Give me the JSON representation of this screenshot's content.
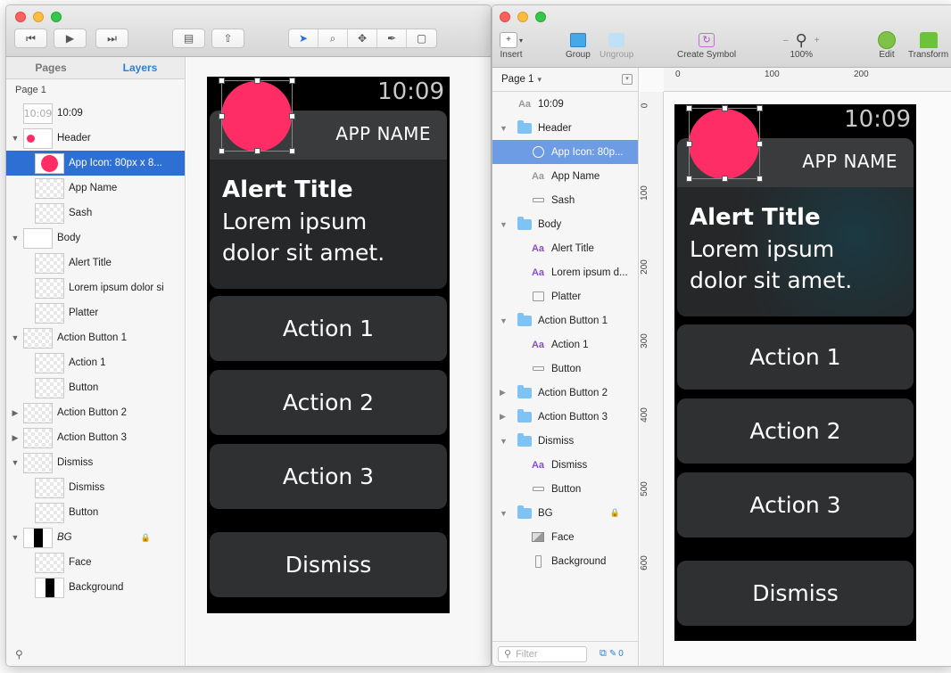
{
  "left": {
    "sidebar": {
      "tabs": [
        "Pages",
        "Layers"
      ],
      "page_label": "Page 1",
      "layers": [
        {
          "label": "10:09",
          "thumb": "time",
          "level": 0,
          "sel": false
        },
        {
          "label": "Header",
          "thumb": "dot",
          "level": 0,
          "sel": false,
          "expand": "open"
        },
        {
          "label": "App Icon: 80px x 8...",
          "thumb": "circle",
          "level": 1,
          "sel": true
        },
        {
          "label": "App Name",
          "thumb": "check",
          "level": 1,
          "sel": false
        },
        {
          "label": "Sash",
          "thumb": "check",
          "level": 1,
          "sel": false
        },
        {
          "label": "Body",
          "thumb": "plain",
          "level": 0,
          "sel": false,
          "expand": "open"
        },
        {
          "label": "Alert Title",
          "thumb": "check",
          "level": 1,
          "sel": false
        },
        {
          "label": "Lorem ipsum dolor si",
          "thumb": "check",
          "level": 1,
          "sel": false
        },
        {
          "label": "Platter",
          "thumb": "check",
          "level": 1,
          "sel": false
        },
        {
          "label": "Action Button 1",
          "thumb": "check",
          "level": 0,
          "sel": false,
          "expand": "open"
        },
        {
          "label": "Action 1",
          "thumb": "check",
          "level": 1,
          "sel": false
        },
        {
          "label": "Button",
          "thumb": "check",
          "level": 1,
          "sel": false
        },
        {
          "label": "Action Button 2",
          "thumb": "check",
          "level": 0,
          "sel": false,
          "expand": "closed"
        },
        {
          "label": "Action Button 3",
          "thumb": "check",
          "level": 0,
          "sel": false,
          "expand": "closed"
        },
        {
          "label": "Dismiss",
          "thumb": "check",
          "level": 0,
          "sel": false,
          "expand": "open"
        },
        {
          "label": "Dismiss",
          "thumb": "check",
          "level": 1,
          "sel": false
        },
        {
          "label": "Button",
          "thumb": "check",
          "level": 1,
          "sel": false
        },
        {
          "label": "BG",
          "thumb": "bar",
          "level": 0,
          "sel": false,
          "expand": "open",
          "italic": true,
          "lock": true
        },
        {
          "label": "Face",
          "thumb": "check",
          "level": 1,
          "sel": false
        },
        {
          "label": "Background",
          "thumb": "bar",
          "level": 1,
          "sel": false
        }
      ]
    }
  },
  "watch": {
    "time": "10:09",
    "app_name": "APP NAME",
    "alert_title": "Alert Title",
    "alert_body_1": "Lorem ipsum",
    "alert_body_2": "dolor sit amet.",
    "actions": [
      "Action 1",
      "Action 2",
      "Action 3"
    ],
    "dismiss": "Dismiss",
    "icon_color": "#ff2d66"
  },
  "right": {
    "toolbar": {
      "insert": "Insert",
      "group": "Group",
      "ungroup": "Ungroup",
      "create_symbol": "Create Symbol",
      "zoom_minus": "–",
      "zoom_plus": "+",
      "zoom": "100%",
      "edit": "Edit",
      "transform": "Transform"
    },
    "page_select": "Page 1",
    "layers": [
      {
        "label": "10:09",
        "icon": "text-gray",
        "level": 0
      },
      {
        "label": "Header",
        "icon": "folder",
        "level": 0,
        "expand": "open"
      },
      {
        "label": "App Icon: 80p...",
        "icon": "oval",
        "level": 1,
        "sel": true
      },
      {
        "label": "App Name",
        "icon": "text-gray",
        "level": 1
      },
      {
        "label": "Sash",
        "icon": "rect-small",
        "level": 1
      },
      {
        "label": "Body",
        "icon": "folder",
        "level": 0,
        "expand": "open"
      },
      {
        "label": "Alert Title",
        "icon": "text",
        "level": 1
      },
      {
        "label": "Lorem ipsum d...",
        "icon": "text",
        "level": 1
      },
      {
        "label": "Platter",
        "icon": "rect",
        "level": 1
      },
      {
        "label": "Action Button 1",
        "icon": "folder",
        "level": 0,
        "expand": "open"
      },
      {
        "label": "Action 1",
        "icon": "text",
        "level": 1
      },
      {
        "label": "Button",
        "icon": "rect-small",
        "level": 1
      },
      {
        "label": "Action Button 2",
        "icon": "folder",
        "level": 0,
        "expand": "closed"
      },
      {
        "label": "Action Button 3",
        "icon": "folder",
        "level": 0,
        "expand": "closed"
      },
      {
        "label": "Dismiss",
        "icon": "folder",
        "level": 0,
        "expand": "open"
      },
      {
        "label": "Dismiss",
        "icon": "text",
        "level": 1
      },
      {
        "label": "Button",
        "icon": "rect-small",
        "level": 1
      },
      {
        "label": "BG",
        "icon": "folder",
        "level": 0,
        "expand": "open",
        "lock": true
      },
      {
        "label": "Face",
        "icon": "image",
        "level": 1
      },
      {
        "label": "Background",
        "icon": "rect-tall",
        "level": 1
      }
    ],
    "filter_placeholder": "Filter",
    "filter_count": "0",
    "ruler_top": [
      "0",
      "100",
      "200"
    ],
    "ruler_left": [
      "0",
      "100",
      "200",
      "300",
      "400",
      "500",
      "600"
    ]
  }
}
